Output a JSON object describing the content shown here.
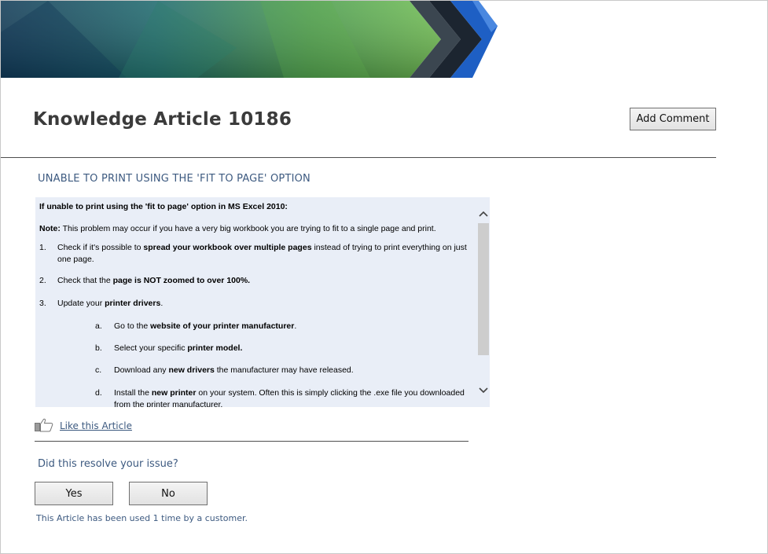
{
  "header": {
    "title": "Knowledge Article 10186",
    "add_comment_label": "Add Comment"
  },
  "article": {
    "subtitle": "UNABLE TO PRINT USING THE 'FIT TO PAGE' OPTION",
    "heading": "If unable to print using the 'fit to page' option in MS Excel 2010:",
    "note_label": "Note:",
    "note_text": " This problem may occur if you have a very big workbook you are trying to fit to a single page and print.",
    "steps": [
      {
        "num": "1.",
        "pre": "Check if it's possible to ",
        "bold": "spread your workbook over multiple pages",
        "post": " instead of trying to print everything on just one page."
      },
      {
        "num": "2.",
        "pre": "Check that the ",
        "bold": "page is NOT zoomed to over 100%.",
        "post": ""
      },
      {
        "num": "3.",
        "pre": "Update your ",
        "bold": "printer drivers",
        "post": "."
      }
    ],
    "substeps": [
      {
        "num": "a.",
        "pre": "Go to the ",
        "bold": "website of your printer manufacturer",
        "post": "."
      },
      {
        "num": "b.",
        "pre": "Select your specific ",
        "bold": "printer model.",
        "post": ""
      },
      {
        "num": "c.",
        "pre": "Download any ",
        "bold": "new drivers",
        "post": " the manufacturer may have released."
      },
      {
        "num": "d.",
        "pre": "Install the ",
        "bold": "new printer",
        "post": " on your system. Often this is simply clicking the .exe file you downloaded from the printer manufacturer."
      }
    ]
  },
  "like": {
    "label": "Like this Article",
    "icon": "thumbs-up-icon"
  },
  "feedback": {
    "question": "Did this resolve your issue?",
    "yes_label": "Yes",
    "no_label": "No",
    "usage_text": "This Article has been used 1 time by a customer."
  },
  "colors": {
    "title": "#3b3b3b",
    "accent_text": "#3d5a80",
    "article_background": "#e9eef7",
    "banner_green": "#4fa84a",
    "banner_blue": "#1e5fc4",
    "banner_dark": "#2c3a45"
  }
}
